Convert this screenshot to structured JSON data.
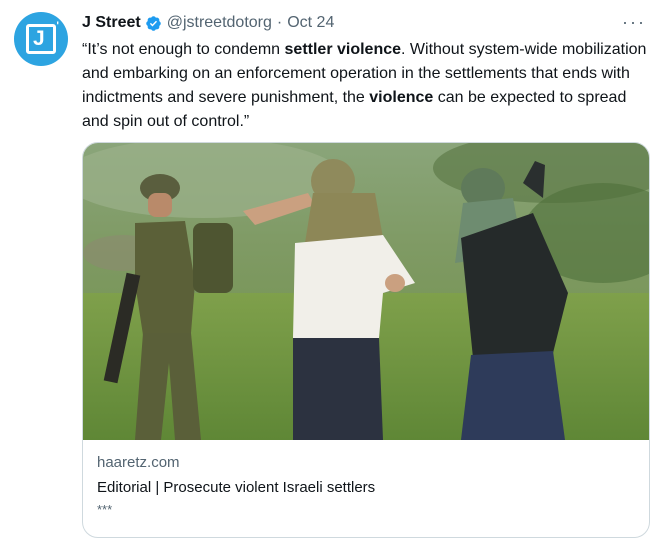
{
  "author": {
    "name": "J Street",
    "handle": "@jstreetdotorg",
    "separator": "·",
    "timestamp": "Oct 24",
    "verified_color": "#1d9bf0",
    "avatar_color": "#2da4e1",
    "avatar_letter": "J"
  },
  "more_icon": "more-horizontal-icon",
  "more_glyph": "···",
  "tweet": {
    "segments": [
      {
        "text": "“It’s not enough to condemn ",
        "bold": false
      },
      {
        "text": "settler violence",
        "bold": true
      },
      {
        "text": ". Without system-wide mobilization and embarking on an enforcement operation in the settlements that ends with indictments and severe punishment, the ",
        "bold": false
      },
      {
        "text": "violence",
        "bold": true
      },
      {
        "text": " can be expected to spread and spin out of control.”",
        "bold": false
      }
    ]
  },
  "card": {
    "domain": "haaretz.com",
    "title": "Editorial | Prosecute violent Israeli settlers",
    "description": "***"
  }
}
